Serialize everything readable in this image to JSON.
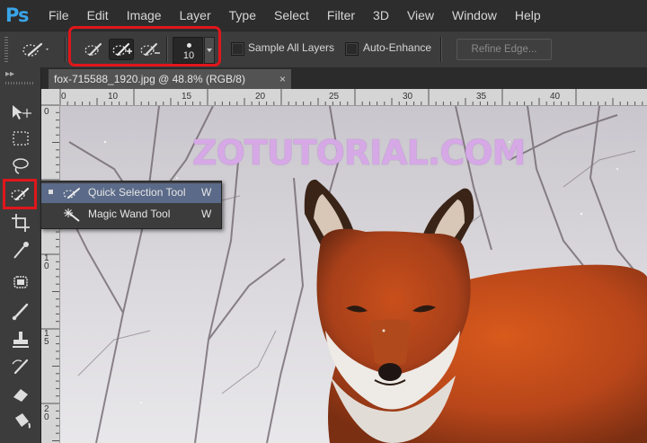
{
  "app": {
    "logo": "Ps"
  },
  "menu": [
    "File",
    "Edit",
    "Image",
    "Layer",
    "Type",
    "Select",
    "Filter",
    "3D",
    "View",
    "Window",
    "Help"
  ],
  "options": {
    "brush_size": "10",
    "sample_all_layers_label": "Sample All Layers",
    "sample_all_layers_checked": false,
    "auto_enhance_label": "Auto-Enhance",
    "auto_enhance_checked": false,
    "refine_edge_label": "Refine Edge..."
  },
  "document": {
    "tab_title": "fox-715588_1920.jpg @ 48.8% (RGB/8)",
    "close_glyph": "×"
  },
  "ruler": {
    "top_labels": [
      "0",
      "5",
      "10",
      "15",
      "20",
      "25",
      "30",
      "35",
      "40"
    ],
    "left_labels": [
      "0",
      "5",
      "1\n0",
      "1\n5",
      "2\n0"
    ]
  },
  "watermark": "ZOTUTORIAL.COM",
  "flyout": {
    "items": [
      {
        "label": "Quick Selection Tool",
        "shortcut": "W",
        "selected": true
      },
      {
        "label": "Magic Wand Tool",
        "shortcut": "W",
        "selected": false
      }
    ]
  },
  "colors": {
    "accent_highlight": "#e0161b",
    "ps_blue": "#3aa5e8",
    "selected_menu": "#5a6a88"
  },
  "toolbar_icons": [
    "move-tool-icon",
    "marquee-tool-icon",
    "lasso-tool-icon",
    "quick-selection-tool-icon",
    "crop-tool-icon",
    "eyedropper-tool-icon",
    "spot-healing-tool-icon",
    "brush-tool-icon",
    "clone-stamp-tool-icon",
    "history-brush-tool-icon",
    "eraser-tool-icon",
    "paint-bucket-tool-icon"
  ]
}
